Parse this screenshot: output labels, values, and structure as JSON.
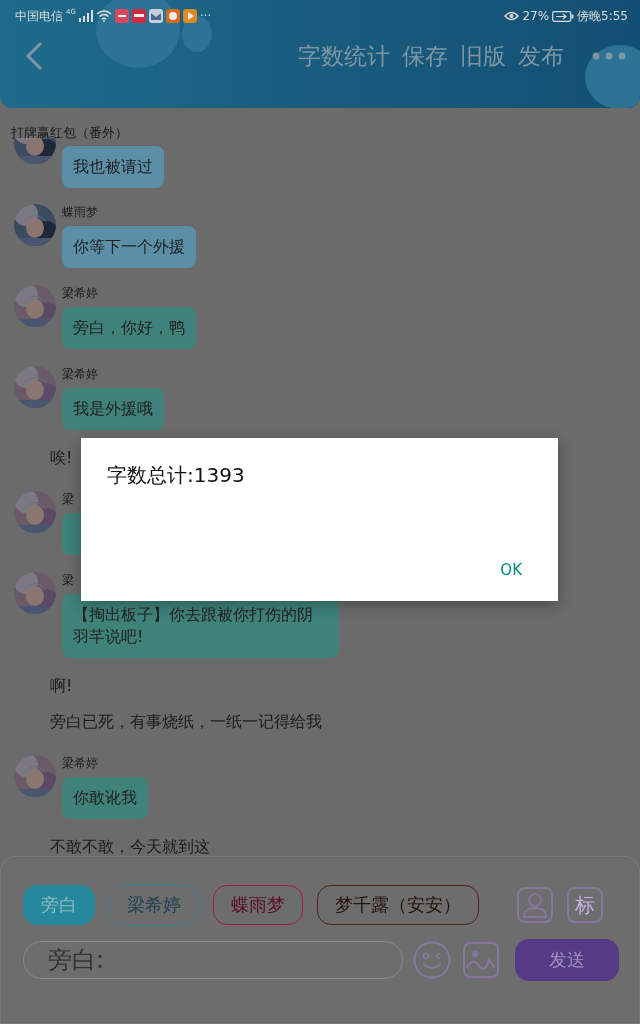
{
  "status_bar": {
    "carrier": "中国电信",
    "network": "4G",
    "more": "···",
    "eye_reading": "27%",
    "time": "傍晚5:55"
  },
  "toolbar": {
    "actions": [
      "字数统计",
      "保存",
      "旧版",
      "发布"
    ]
  },
  "document_title": "打牌赢红包（番外）",
  "messages": [
    {
      "kind": "bubble",
      "text": "我也被请过",
      "color": "#5b8fa8"
    },
    {
      "kind": "bubble",
      "speaker": "蝶雨梦",
      "text": "你等下一个外援",
      "color": "#5b8fa8"
    },
    {
      "kind": "bubble",
      "speaker": "梁希婷",
      "text": "旁白，你好，鸭",
      "color": "#3f827a"
    },
    {
      "kind": "bubble",
      "speaker": "梁希婷",
      "text": "我是外援哦",
      "color": "#3f827a"
    },
    {
      "kind": "narration",
      "text": "唉!"
    },
    {
      "kind": "bubble",
      "speaker": "梁",
      "color": "#3f827a"
    },
    {
      "kind": "bubble",
      "speaker": "梁",
      "text": "【掏出板子】你去跟被你打伤的阴羽芊说吧!",
      "color": "#3f827a"
    },
    {
      "kind": "narration",
      "text": "啊!"
    },
    {
      "kind": "narration",
      "text": "旁白已死，有事烧纸，一纸一记得给我"
    },
    {
      "kind": "bubble",
      "speaker": "梁希婷",
      "text": "你敢讹我",
      "color": "#3f827a"
    },
    {
      "kind": "narration",
      "text": "不敢不敢，今天就到这"
    }
  ],
  "composer": {
    "characters": [
      {
        "label": "旁白",
        "color": "#26889c",
        "selected": true
      },
      {
        "label": "梁希婷",
        "color": "#3e7a8e",
        "selected": false
      },
      {
        "label": "蝶雨梦",
        "color": "#a3194a",
        "selected": false
      },
      {
        "label": "梦千露（安安）",
        "color": "#4a2418",
        "selected": false
      }
    ],
    "tag_button": "标",
    "placeholder": "旁白:",
    "send": "发送"
  },
  "dialog": {
    "message": "字数总计:1393",
    "ok": "OK"
  }
}
